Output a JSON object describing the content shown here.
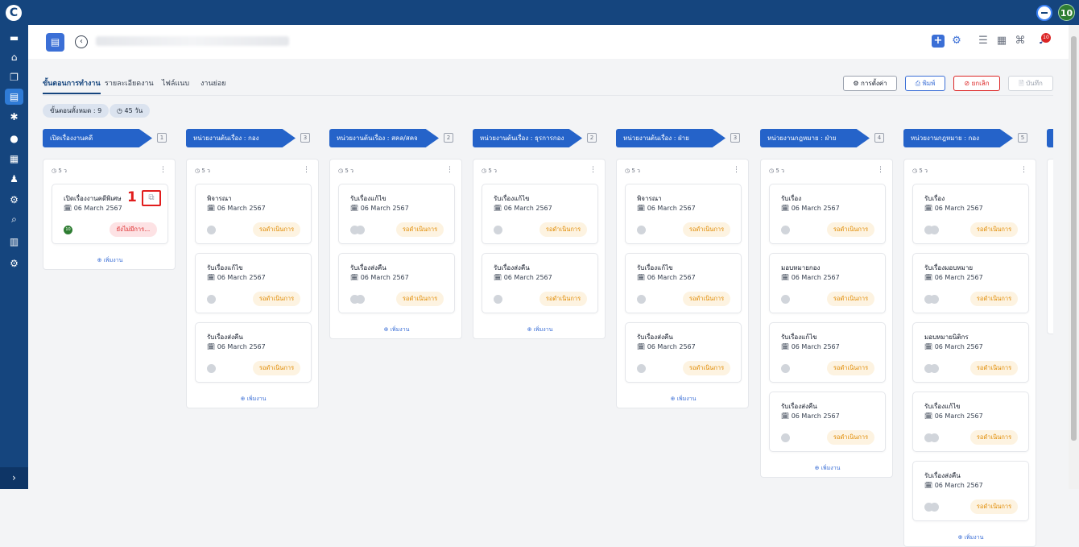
{
  "topbar": {
    "user_initials": "10"
  },
  "header": {
    "bell_badge": "10"
  },
  "tabs": [
    {
      "label": "ขั้นตอนการทำงาน",
      "active": true
    },
    {
      "label": "รายละเอียดงาน"
    },
    {
      "label": "ไฟล์แนบ"
    },
    {
      "label": "งานย่อย"
    }
  ],
  "actions": {
    "settings": "⚙ การตั้งค่า",
    "print": "⎙ พิมพ์",
    "cancel": "⊘ ยกเลิก",
    "save": "🗎 บันทึก"
  },
  "summary": {
    "steps": "ขั้นตอนทั้งหมด : 9",
    "days": "◷ 45 วัน"
  },
  "columns": [
    {
      "title": "เปิดเรื่องงานคดี",
      "count": "1",
      "meta": "◷ 5 ว",
      "add": "⊕ เพิ่มงาน",
      "cards": [
        {
          "title": "เปิดเรื่องงานคดีพิเศษ",
          "date": "🗓 06 March 2567",
          "status": "ยังไม่มีการ...",
          "avatar": "10"
        }
      ]
    },
    {
      "title": "หน่วยงานต้นเรื่อง : กอง",
      "count": "3",
      "meta": "◷ 5 ว",
      "add": "⊕ เพิ่มงาน",
      "cards": [
        {
          "title": "พิจารณา",
          "date": "🗓 06 March 2567",
          "status": "รอดำเนินการ"
        },
        {
          "title": "รับเรื่องแก้ไข",
          "date": "🗓 06 March 2567",
          "status": "รอดำเนินการ"
        },
        {
          "title": "รับเรื่องส่งคืน",
          "date": "🗓 06 March 2567",
          "status": "รอดำเนินการ"
        }
      ]
    },
    {
      "title": "หน่วยงานต้นเรื่อง : สคล/สคจ",
      "count": "2",
      "meta": "◷ 5 ว",
      "add": "⊕ เพิ่มงาน",
      "cards": [
        {
          "title": "รับเรื่องแก้ไข",
          "date": "🗓 06 March 2567",
          "status": "รอดำเนินการ"
        },
        {
          "title": "รับเรื่องส่งคืน",
          "date": "🗓 06 March 2567",
          "status": "รอดำเนินการ"
        }
      ]
    },
    {
      "title": "หน่วยงานต้นเรื่อง : ธุรการกอง",
      "count": "2",
      "meta": "◷ 5 ว",
      "add": "⊕ เพิ่มงาน",
      "cards": [
        {
          "title": "รับเรื่องแก้ไข",
          "date": "🗓 06 March 2567",
          "status": "รอดำเนินการ"
        },
        {
          "title": "รับเรื่องส่งคืน",
          "date": "🗓 06 March 2567",
          "status": "รอดำเนินการ"
        }
      ]
    },
    {
      "title": "หน่วยงานต้นเรื่อง : ฝ่าย",
      "count": "3",
      "meta": "◷ 5 ว",
      "add": "⊕ เพิ่มงาน",
      "cards": [
        {
          "title": "พิจารณา",
          "date": "🗓 06 March 2567",
          "status": "รอดำเนินการ"
        },
        {
          "title": "รับเรื่องแก้ไข",
          "date": "🗓 06 March 2567",
          "status": "รอดำเนินการ"
        },
        {
          "title": "รับเรื่องส่งคืน",
          "date": "🗓 06 March 2567",
          "status": "รอดำเนินการ"
        }
      ]
    },
    {
      "title": "หน่วยงานกฎหมาย : ฝ่าย",
      "count": "4",
      "meta": "◷ 5 ว",
      "add": "⊕ เพิ่มงาน",
      "cards": [
        {
          "title": "รับเรื่อง",
          "date": "🗓 06 March 2567",
          "status": "รอดำเนินการ"
        },
        {
          "title": "มอบหมายกอง",
          "date": "🗓 06 March 2567",
          "status": "รอดำเนินการ"
        },
        {
          "title": "รับเรื่องแก้ไข",
          "date": "🗓 06 March 2567",
          "status": "รอดำเนินการ"
        },
        {
          "title": "รับเรื่องส่งคืน",
          "date": "🗓 06 March 2567",
          "status": "รอดำเนินการ"
        }
      ]
    },
    {
      "title": "หน่วยงานกฎหมาย : กอง",
      "count": "5",
      "meta": "◷ 5 ว",
      "add": "⊕ เพิ่มงาน",
      "cards": [
        {
          "title": "รับเรื่อง",
          "date": "🗓 06 March 2567",
          "status": "รอดำเนินการ"
        },
        {
          "title": "รับเรื่องมอบหมาย",
          "date": "🗓 06 March 2567",
          "status": "รอดำเนินการ"
        },
        {
          "title": "มอบหมายนิติกร",
          "date": "🗓 06 March 2567",
          "status": "รอดำเนินการ"
        },
        {
          "title": "รับเรื่องแก้ไข",
          "date": "🗓 06 March 2567",
          "status": "รอดำเนินการ"
        },
        {
          "title": "รับเรื่องส่งคืน",
          "date": "🗓 06 March 2567",
          "status": "รอดำเนินการ"
        }
      ]
    }
  ],
  "annotation": "1",
  "colors": {
    "primary": "#15457e",
    "accent": "#2563c9",
    "status_pending": "#e08a00",
    "status_none": "#dc2626"
  }
}
